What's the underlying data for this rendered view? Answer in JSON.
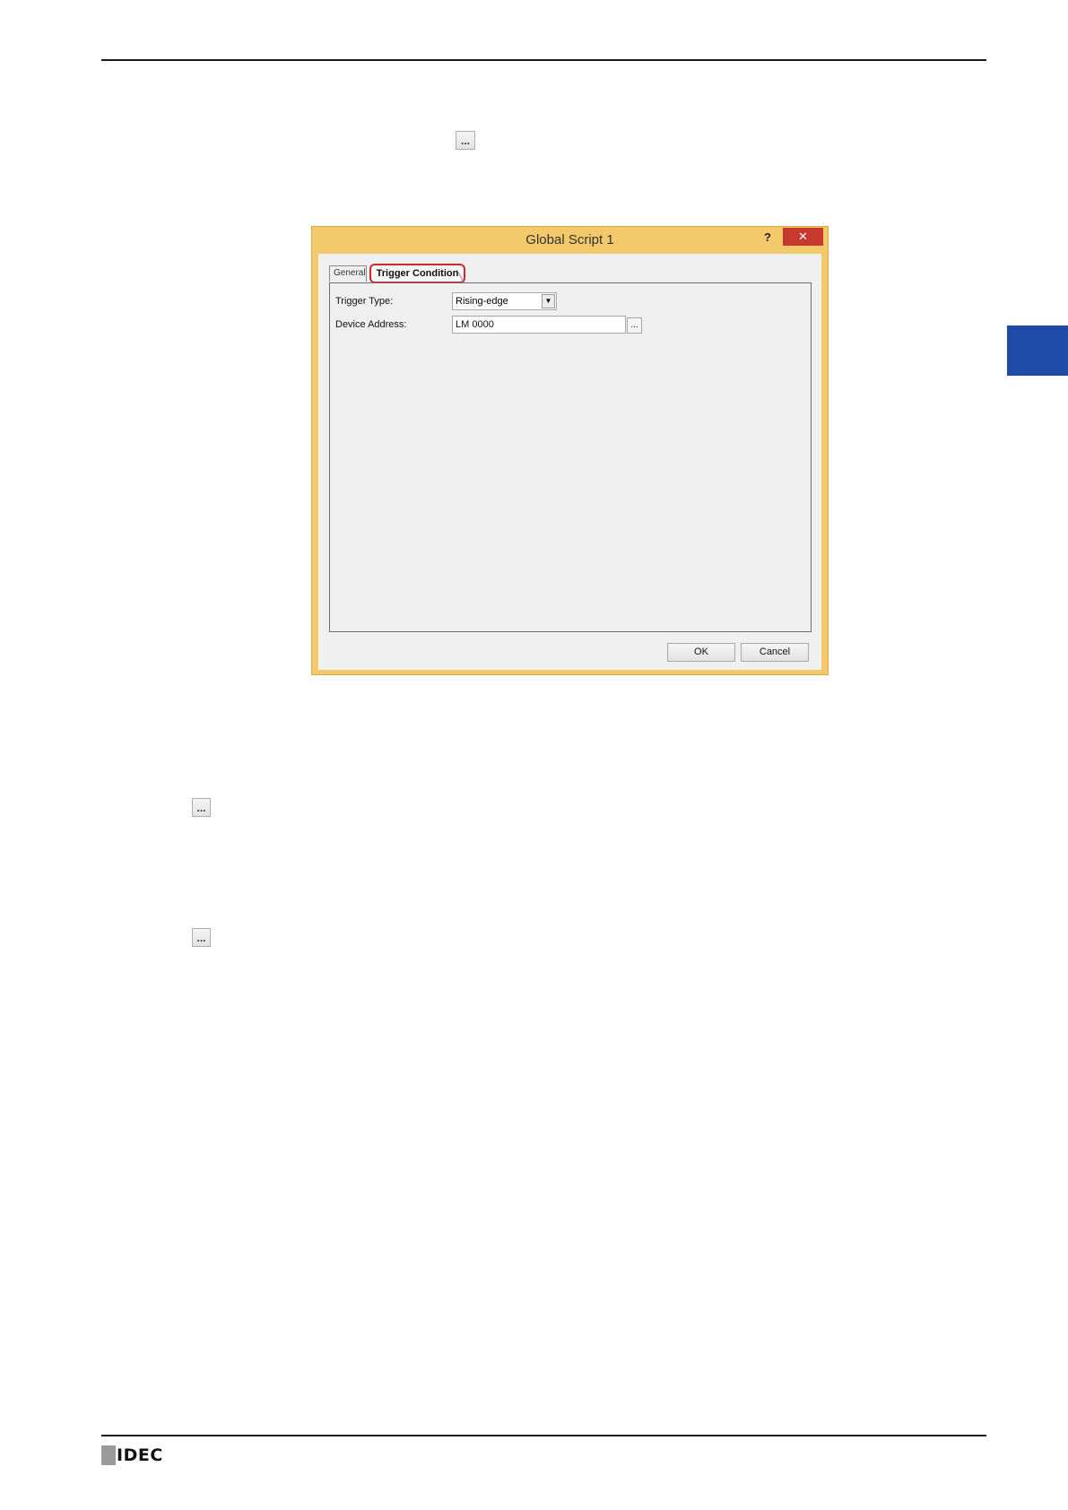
{
  "header": {},
  "inline_buttons": {
    "ellipsis": "..."
  },
  "dialog": {
    "title": "Global Script 1",
    "help_label": "?",
    "close_label": "✕",
    "tabs": [
      {
        "label": "General"
      },
      {
        "label": "Trigger Condition"
      }
    ],
    "fields": {
      "trigger_type_label": "Trigger Type:",
      "trigger_type_value": "Rising-edge",
      "device_address_label": "Device Address:",
      "device_address_value": "LM 0000",
      "browse_label": "..."
    },
    "buttons": {
      "ok": "OK",
      "cancel": "Cancel"
    }
  },
  "footer": {
    "logo_text": "IDEC"
  },
  "colors": {
    "dialog_frame": "#f2c96b",
    "close_button": "#c7392c",
    "highlight": "#d2272c",
    "side_tab": "#1f4aa8"
  }
}
